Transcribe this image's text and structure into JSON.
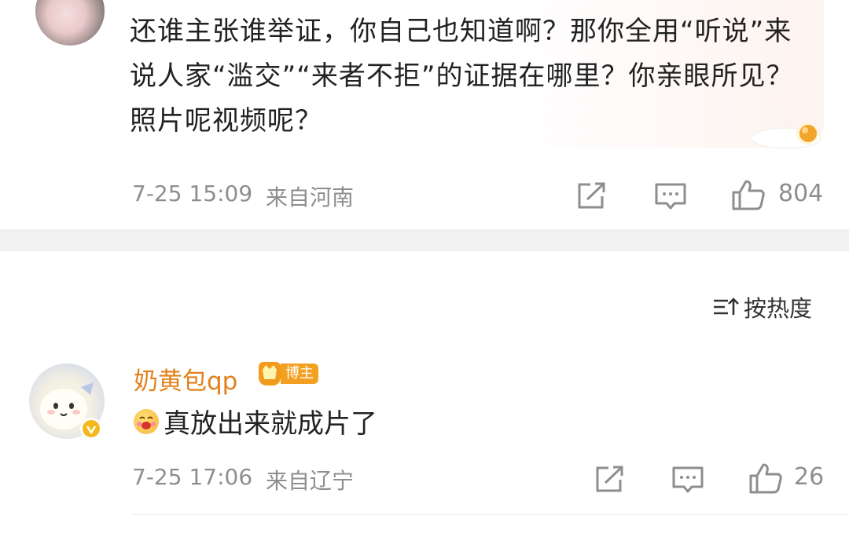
{
  "comment1": {
    "text": "还谁主张谁举证，你自己也知道啊？那你全用“听说”来说人家“滥交”“来者不拒”的证据在哪里？你亲眼所见？照片呢视频呢？",
    "time": "7-25 15:09",
    "location": "来自河南",
    "like_count": "804"
  },
  "sort": {
    "label": "按热度"
  },
  "comment2": {
    "username": "奶黄包qp",
    "badge": "博主",
    "text": "真放出来就成片了",
    "time": "7-25 17:06",
    "location": "来自辽宁",
    "like_count": "26"
  },
  "colors": {
    "username": "#e2811a",
    "meta": "#8e8e8e",
    "badge": "#f2a021",
    "verified": "#f5b81c",
    "divider": "#f1f1f1"
  },
  "icons": [
    "share-icon",
    "comment-icon",
    "like-icon",
    "sort-icon",
    "verified-icon",
    "badge-crown-icon",
    "emoji-icon",
    "egg-decoration"
  ]
}
